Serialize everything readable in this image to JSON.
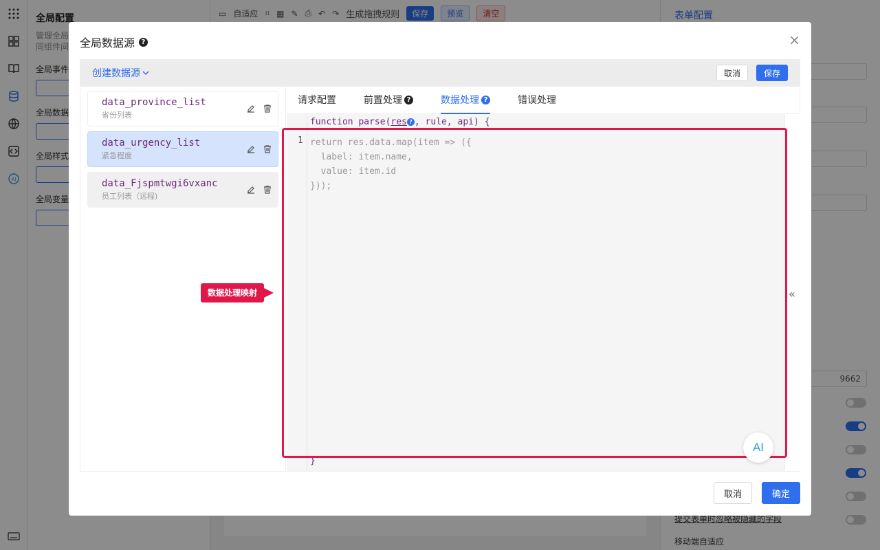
{
  "background": {
    "left_panel": {
      "title": "全局配置",
      "desc_line1": "管理全局",
      "desc_line2": "同组件间",
      "sections": [
        "全局事件",
        "全局数据",
        "全局样式",
        "全局变量"
      ]
    },
    "toolbar": {
      "adapt": "自适应",
      "rule": "生成拖拽规则",
      "save": "保存",
      "preview": "预览",
      "clear": "清空"
    },
    "right_panel": {
      "title": "表单配置",
      "partial_value": "9662",
      "ignore_hidden_label": "提交表单时忽略被隐藏的字段",
      "mobile_label": "移动端自适应"
    }
  },
  "modal": {
    "title": "全局数据源",
    "close": "×",
    "create_label": "创建数据源",
    "cancel_small": "取消",
    "save_small": "保存",
    "datasources": [
      {
        "name": "data_province_list",
        "sub": "省份列表"
      },
      {
        "name": "data_urgency_list",
        "sub": "紧急程度"
      },
      {
        "name": "data_Fjspmtwgi6vxanc",
        "sub": "员工列表（远程)"
      }
    ],
    "tabs": [
      "请求配置",
      "前置处理",
      "数据处理",
      "错误处理"
    ],
    "editor": {
      "signature_pre": "function parse(",
      "param": "res",
      "signature_post": ", rule, api) {",
      "line_number": "1",
      "body": "return res.data.map(item => ({\n  label: item.name,\n  value: item.id\n}));",
      "closing": "}"
    },
    "callout": "数据处理映射",
    "ai_label": "AI",
    "collapse": "«",
    "footer": {
      "cancel": "取消",
      "confirm": "确定"
    }
  },
  "colors": {
    "accent": "#2f6fed",
    "highlight": "#e0184a",
    "code_keyword": "#6b2a7a"
  }
}
